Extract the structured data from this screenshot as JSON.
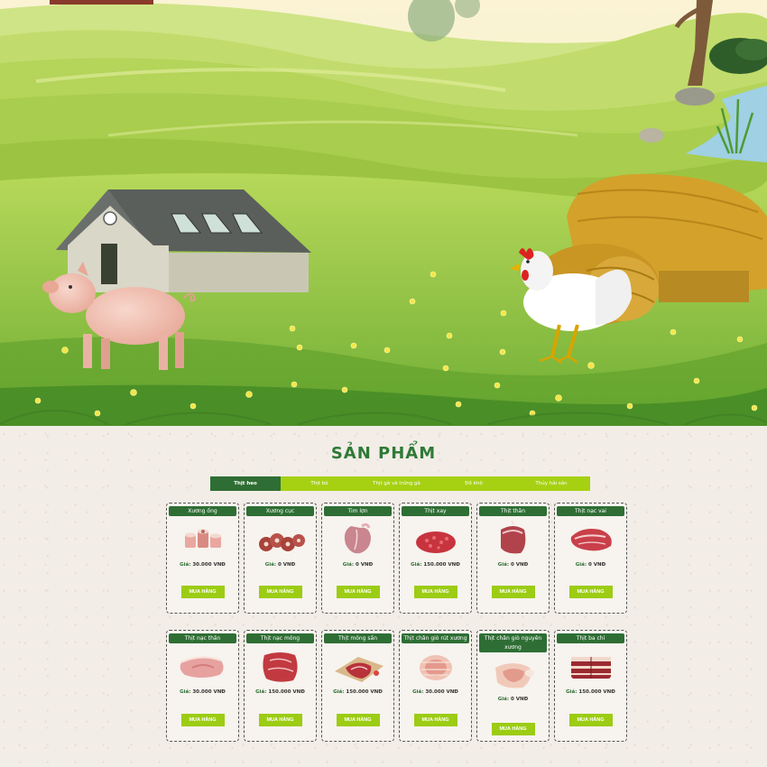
{
  "section_title": "SẢN PHẨM",
  "tabs": [
    {
      "label": "Thịt heo",
      "active": true
    },
    {
      "label": "Thịt bò",
      "active": false
    },
    {
      "label": "Thịt gà và trứng gà",
      "active": false
    },
    {
      "label": "Đồ khô",
      "active": false
    },
    {
      "label": "Thủy hải sản",
      "active": false
    }
  ],
  "price_label": "Giá:",
  "buy_label": "MUA HÀNG",
  "products_row1": [
    {
      "name": "Xương ống",
      "price": "30.000 VNĐ",
      "icon": "pork-bones-image"
    },
    {
      "name": "Xương cục",
      "price": "0 VNĐ",
      "icon": "pork-bone-chunks-image"
    },
    {
      "name": "Tim lợn",
      "price": "0 VNĐ",
      "icon": "pork-heart-image"
    },
    {
      "name": "Thịt xay",
      "price": "150.000 VNĐ",
      "icon": "ground-pork-image"
    },
    {
      "name": "Thịt thăn",
      "price": "0 VNĐ",
      "icon": "pork-loin-image"
    },
    {
      "name": "Thịt nạc vai",
      "price": "0 VNĐ",
      "icon": "pork-shoulder-image"
    }
  ],
  "products_row2": [
    {
      "name": "Thịt nạc thăn",
      "price": "30.000 VNĐ",
      "icon": "lean-loin-image"
    },
    {
      "name": "Thịt nạc mông",
      "price": "150.000 VNĐ",
      "icon": "pork-rump-image"
    },
    {
      "name": "Thịt mông sấn",
      "price": "150.000 VNĐ",
      "icon": "pork-ham-image"
    },
    {
      "name": "Thịt chân giò rút xương",
      "price": "30.000 VNĐ",
      "icon": "boneless-hock-image"
    },
    {
      "name": "Thịt chân giò nguyên xương",
      "price": "0 VNĐ",
      "icon": "bone-in-hock-image"
    },
    {
      "name": "Thịt ba chỉ",
      "price": "150.000 VNĐ",
      "icon": "pork-belly-image"
    }
  ],
  "colors": {
    "dark_green": "#2e6e34",
    "lime": "#9ccc14",
    "title_green": "#2e7a36",
    "background": "#f3ede7"
  }
}
